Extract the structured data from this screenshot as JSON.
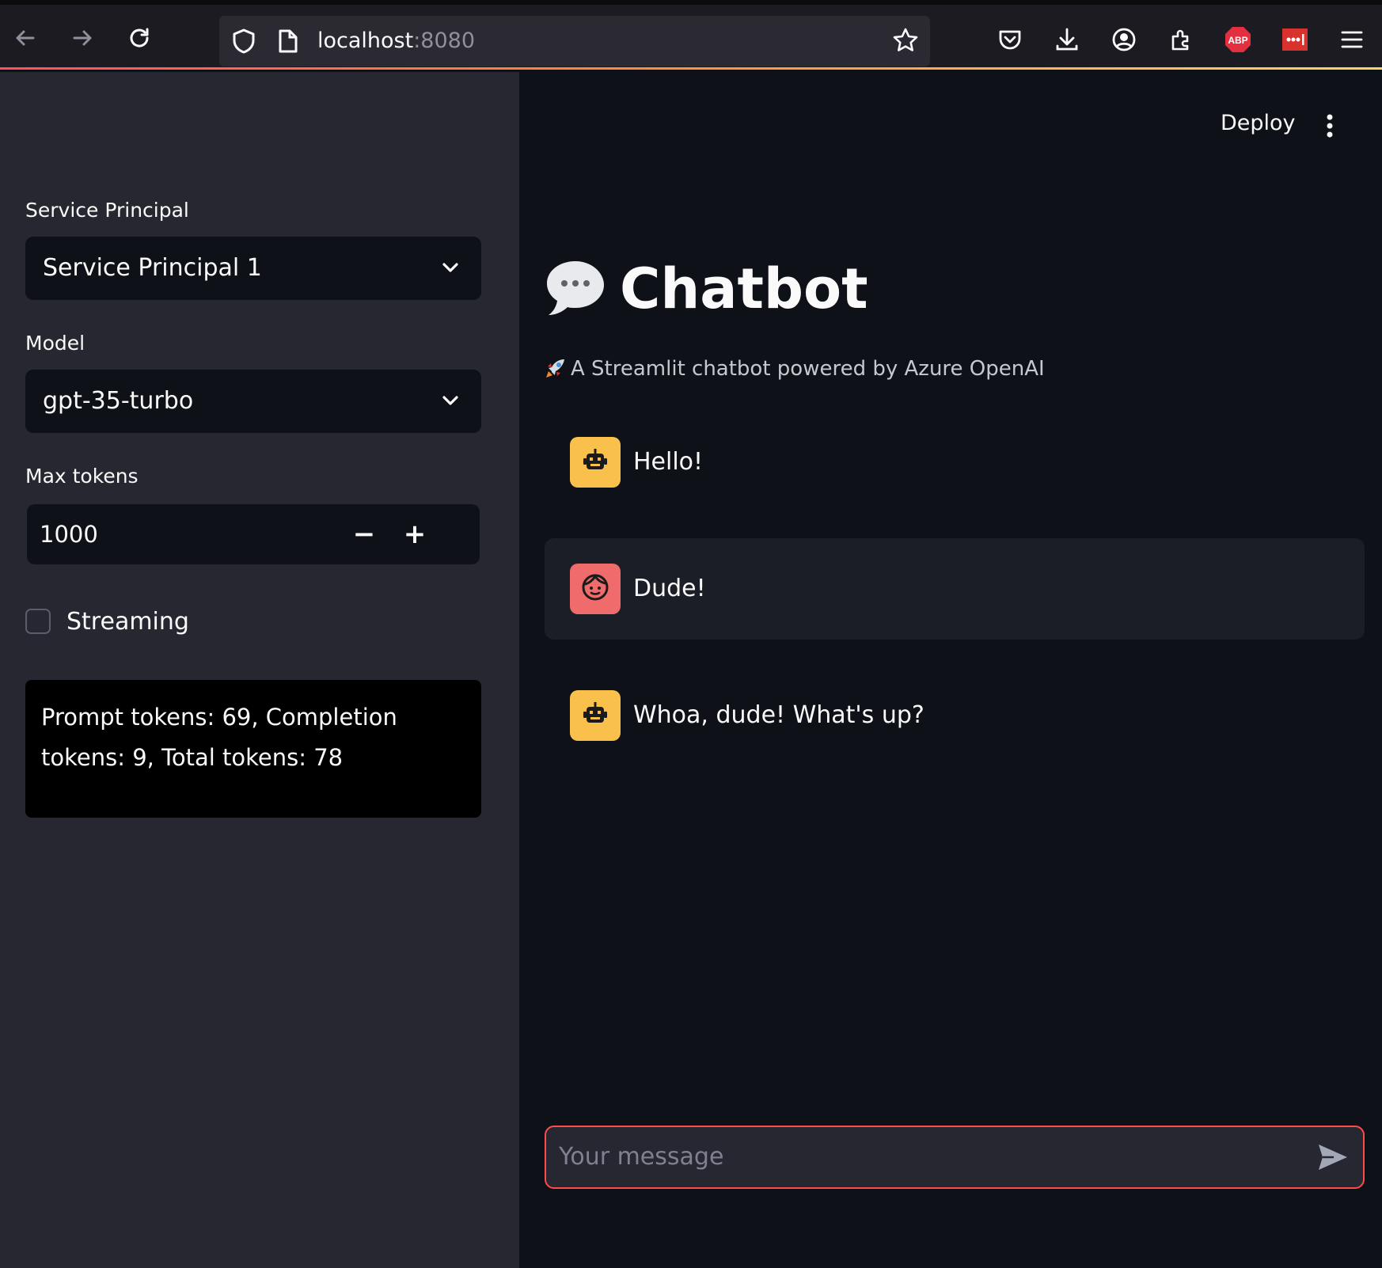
{
  "browser": {
    "url_host": "localhost",
    "url_port": ":8080"
  },
  "sidebar": {
    "service_principal": {
      "label": "Service Principal",
      "value": "Service Principal 1"
    },
    "model": {
      "label": "Model",
      "value": "gpt-35-turbo"
    },
    "max_tokens": {
      "label": "Max tokens",
      "value": "1000",
      "decrement": "−",
      "increment": "+"
    },
    "streaming": {
      "label": "Streaming",
      "checked": false
    },
    "usage_info": "Prompt tokens: 69, Completion tokens: 9, Total tokens: 78"
  },
  "header": {
    "deploy_label": "Deploy"
  },
  "main": {
    "title": "Chatbot",
    "subtitle": "A Streamlit chatbot powered by Azure OpenAI",
    "messages": [
      {
        "role": "assistant",
        "text": "Hello!"
      },
      {
        "role": "user",
        "text": "Dude!"
      },
      {
        "role": "assistant",
        "text": "Whoa, dude! What's up?"
      }
    ],
    "input_placeholder": "Your message"
  },
  "colors": {
    "accent": "#ff4b4b",
    "bot_avatar": "#f9c04b",
    "user_avatar": "#f06b6b",
    "sidebar_bg": "#262730",
    "main_bg": "#0e1117"
  }
}
